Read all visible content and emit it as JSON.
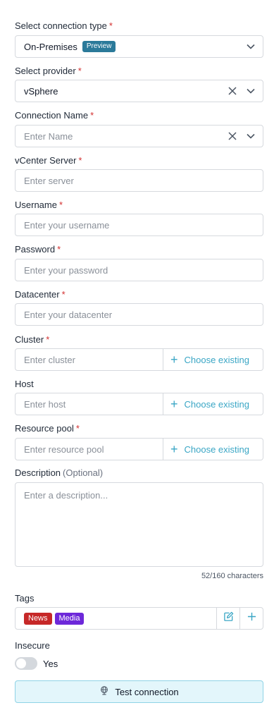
{
  "form": {
    "connection_type": {
      "label": "Select connection type",
      "required": "*",
      "value": "On-Premises",
      "badge": "Preview",
      "icon": "chevron-down-icon"
    },
    "provider": {
      "label": "Select provider",
      "required": "*",
      "value": "vSphere",
      "icons": [
        "close-icon",
        "chevron-down-icon"
      ]
    },
    "connection_name": {
      "label": "Connection Name",
      "required": "*",
      "placeholder": "Enter Name",
      "icons": [
        "close-icon",
        "chevron-down-icon"
      ]
    },
    "vcenter_server": {
      "label": "vCenter Server",
      "required": "*",
      "placeholder": "Enter server"
    },
    "username": {
      "label": "Username",
      "required": "*",
      "placeholder": "Enter your username"
    },
    "password": {
      "label": "Password",
      "required": "*",
      "placeholder": "Enter your password"
    },
    "datacenter": {
      "label": "Datacenter",
      "required": "*",
      "placeholder": "Enter your datacenter"
    },
    "cluster": {
      "label": "Cluster",
      "required": "*",
      "placeholder": "Enter cluster",
      "choose_label": "Choose existing"
    },
    "host": {
      "label": "Host",
      "placeholder": "Enter host",
      "choose_label": "Choose existing"
    },
    "resource_pool": {
      "label": "Resource pool",
      "required": "*",
      "placeholder": "Enter resource pool",
      "choose_label": "Choose existing"
    },
    "description": {
      "label": "Description",
      "optional": "(Optional)",
      "placeholder": "Enter a description...",
      "counter": "52/160 characters"
    },
    "tags": {
      "label": "Tags",
      "items": [
        {
          "label": "News",
          "color": "#c62828"
        },
        {
          "label": "Media",
          "color": "#6d28d9"
        }
      ],
      "icons": [
        "edit-icon",
        "plus-icon"
      ]
    },
    "insecure": {
      "label": "Insecure",
      "toggle_label": "Yes",
      "enabled": false
    },
    "test_button": {
      "label": "Test connection",
      "icon": "globe-icon"
    }
  },
  "colors": {
    "required": "#d32f2f",
    "accent": "#3aa6c5",
    "preview_badge": "#2b7a9a",
    "test_button_bg": "#e3f6fb",
    "test_button_border": "#8fd3e6"
  }
}
